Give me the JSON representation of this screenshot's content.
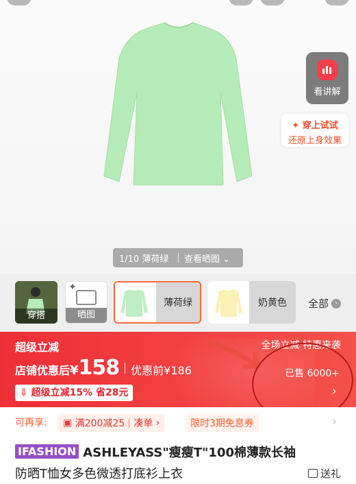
{
  "hero": {
    "pager_counter": "1/10 薄荷绿",
    "pager_action": "查看晒图",
    "explain_label": "看讲解",
    "tryon_line1": "✦ 穿上试试",
    "tryon_line2": "还原上身效果"
  },
  "thumbs": {
    "outfit_label": "穿搭",
    "pic_label": "晒图",
    "sku_items": [
      {
        "name": "薄荷绿",
        "color": "#bfeec4",
        "selected": true
      },
      {
        "name": "奶黄色",
        "color": "#fbf0b6",
        "selected": false
      }
    ],
    "all_label": "全部"
  },
  "promo": {
    "title": "超级立减",
    "right_title": "全场立减 特惠来袭",
    "price_label": "店铺优惠后",
    "currency": "¥",
    "price_value": "158",
    "before_label": "优惠前¥186",
    "sold": "已售 6000+",
    "tag": "超级立减15% 省28元"
  },
  "coupons": {
    "lead": "可再享:",
    "coupon1": "满200减25",
    "coupon1_action": "凑单",
    "coupon2": "限时3期免息券"
  },
  "product": {
    "brand": "IFASHION",
    "title_line1": "ASHLEYASS\"瘦瘦T\"100棉薄款长袖",
    "title_line2": "防晒T恤女多色微透打底衫上衣",
    "gift_label": "送礼"
  },
  "colors": {
    "accent_red": "#ef2f36",
    "tryon_orange": "#ff4c2a",
    "brand_purple": "#9450c6",
    "shirt_mint": "#b6ecb7"
  }
}
